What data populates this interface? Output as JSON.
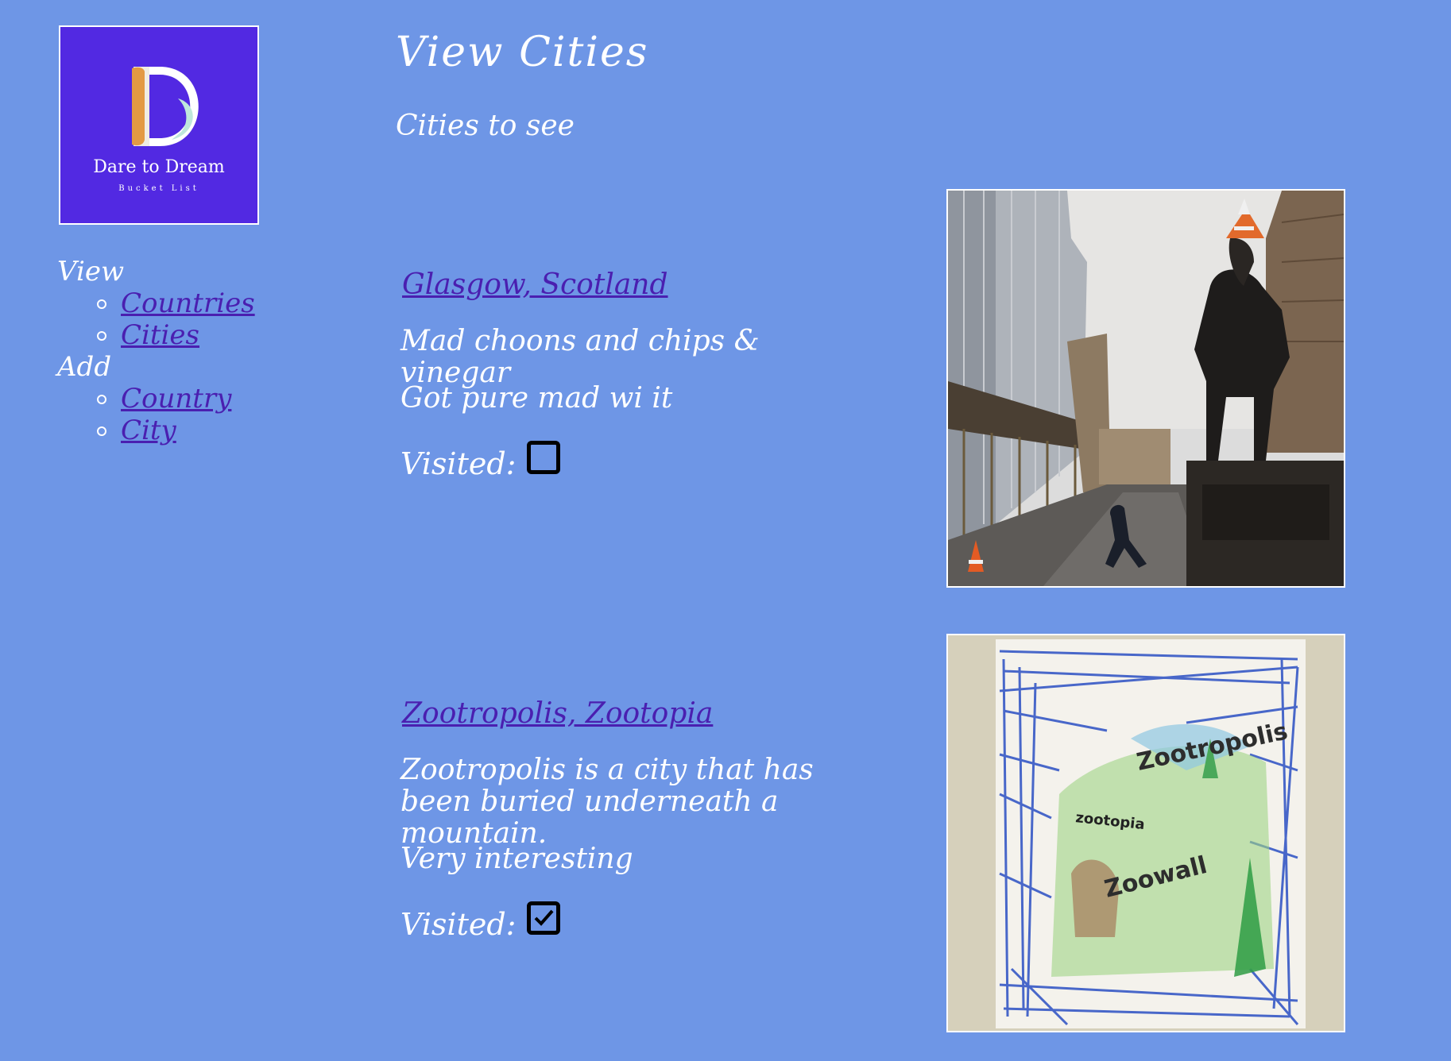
{
  "logo": {
    "letter": "D",
    "title": "Dare to Dream",
    "tagline": "Bucket List"
  },
  "nav": {
    "view_label": "View",
    "view_items": [
      "Countries",
      "Cities"
    ],
    "add_label": "Add",
    "add_items": [
      "Country",
      "City"
    ]
  },
  "page": {
    "title": "View Cities",
    "subtitle": "Cities to see"
  },
  "visited_label": "Visited:",
  "cities": [
    {
      "name": "Glasgow, Scotland",
      "description": "Mad choons and chips & vinegar",
      "note": "Got pure mad wi it",
      "visited": false,
      "image_icon": "street-statue-photo"
    },
    {
      "name": "Zootropolis, Zootopia",
      "description": "Zootropolis is a city that has been buried underneath a mountain.",
      "note": "Very interesting",
      "visited": true,
      "image_icon": "crayon-drawing-photo",
      "drawing_text": [
        "Zootropolis",
        "zootopia",
        "Zoowall"
      ]
    }
  ],
  "colors": {
    "background": "#6e96e6",
    "text": "#ffffff",
    "link": "#4a1fb0",
    "logo_background": "#5229e2",
    "checkbox_border": "#000000"
  }
}
